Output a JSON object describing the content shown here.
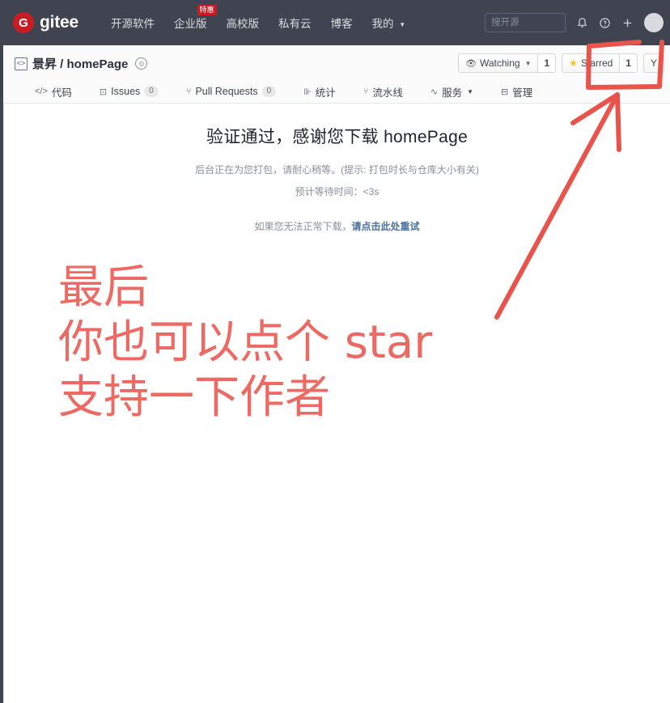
{
  "topnav": {
    "logo_letter": "G",
    "logo_text": "gitee",
    "links": [
      {
        "label": "开源软件",
        "badge": null,
        "caret": false
      },
      {
        "label": "企业版",
        "badge": "特惠",
        "caret": false
      },
      {
        "label": "高校版",
        "badge": null,
        "caret": false
      },
      {
        "label": "私有云",
        "badge": null,
        "caret": false
      },
      {
        "label": "博客",
        "badge": null,
        "caret": false
      },
      {
        "label": "我的",
        "badge": null,
        "caret": true
      }
    ],
    "search_placeholder": "搜开源",
    "icons": {
      "bell": "🔔",
      "help": "?",
      "plus": "+"
    }
  },
  "repo": {
    "code_icon_glyph": "<>",
    "owner": "景昇",
    "separator": "/",
    "name": "homePage",
    "title_full": "景昇 / homePage",
    "badge_icon_glyph": "◎",
    "watch_label": "Watching",
    "watch_count": "1",
    "star_label": "Starred",
    "star_count": "1",
    "fork_label": "Y"
  },
  "tabs": [
    {
      "icon": "</>",
      "label": "代码",
      "count": null,
      "caret": false
    },
    {
      "icon": "⊡",
      "label": "Issues",
      "count": "0",
      "caret": false
    },
    {
      "icon": "⑂",
      "label": "Pull Requests",
      "count": "0",
      "caret": false
    },
    {
      "icon": "⊪",
      "label": "统计",
      "count": null,
      "caret": false
    },
    {
      "icon": "⑂",
      "label": "流水线",
      "count": null,
      "caret": false
    },
    {
      "icon": "∿",
      "label": "服务",
      "count": null,
      "caret": true
    },
    {
      "icon": "⊟",
      "label": "管理",
      "count": null,
      "caret": false
    }
  ],
  "download": {
    "title": "验证通过，感谢您下载 homePage",
    "sub1": "后台正在为您打包，请耐心稍等。(提示: 打包时长与仓库大小有关)",
    "sub2": "预计等待时间：<3s",
    "retry_prefix": "如果您无法正常下载，",
    "retry_link": "请点击此处重试"
  },
  "annotation": {
    "line1": "最后",
    "line2": "你也可以点个 star",
    "line3": "支持一下作者",
    "color": "#ec6a63"
  },
  "colors": {
    "nav_bg": "#3f4450",
    "brand_red": "#c71d23",
    "annotation_red": "#ec6a63",
    "link_blue": "#4a6f9c",
    "star_yellow": "#f5c518"
  }
}
